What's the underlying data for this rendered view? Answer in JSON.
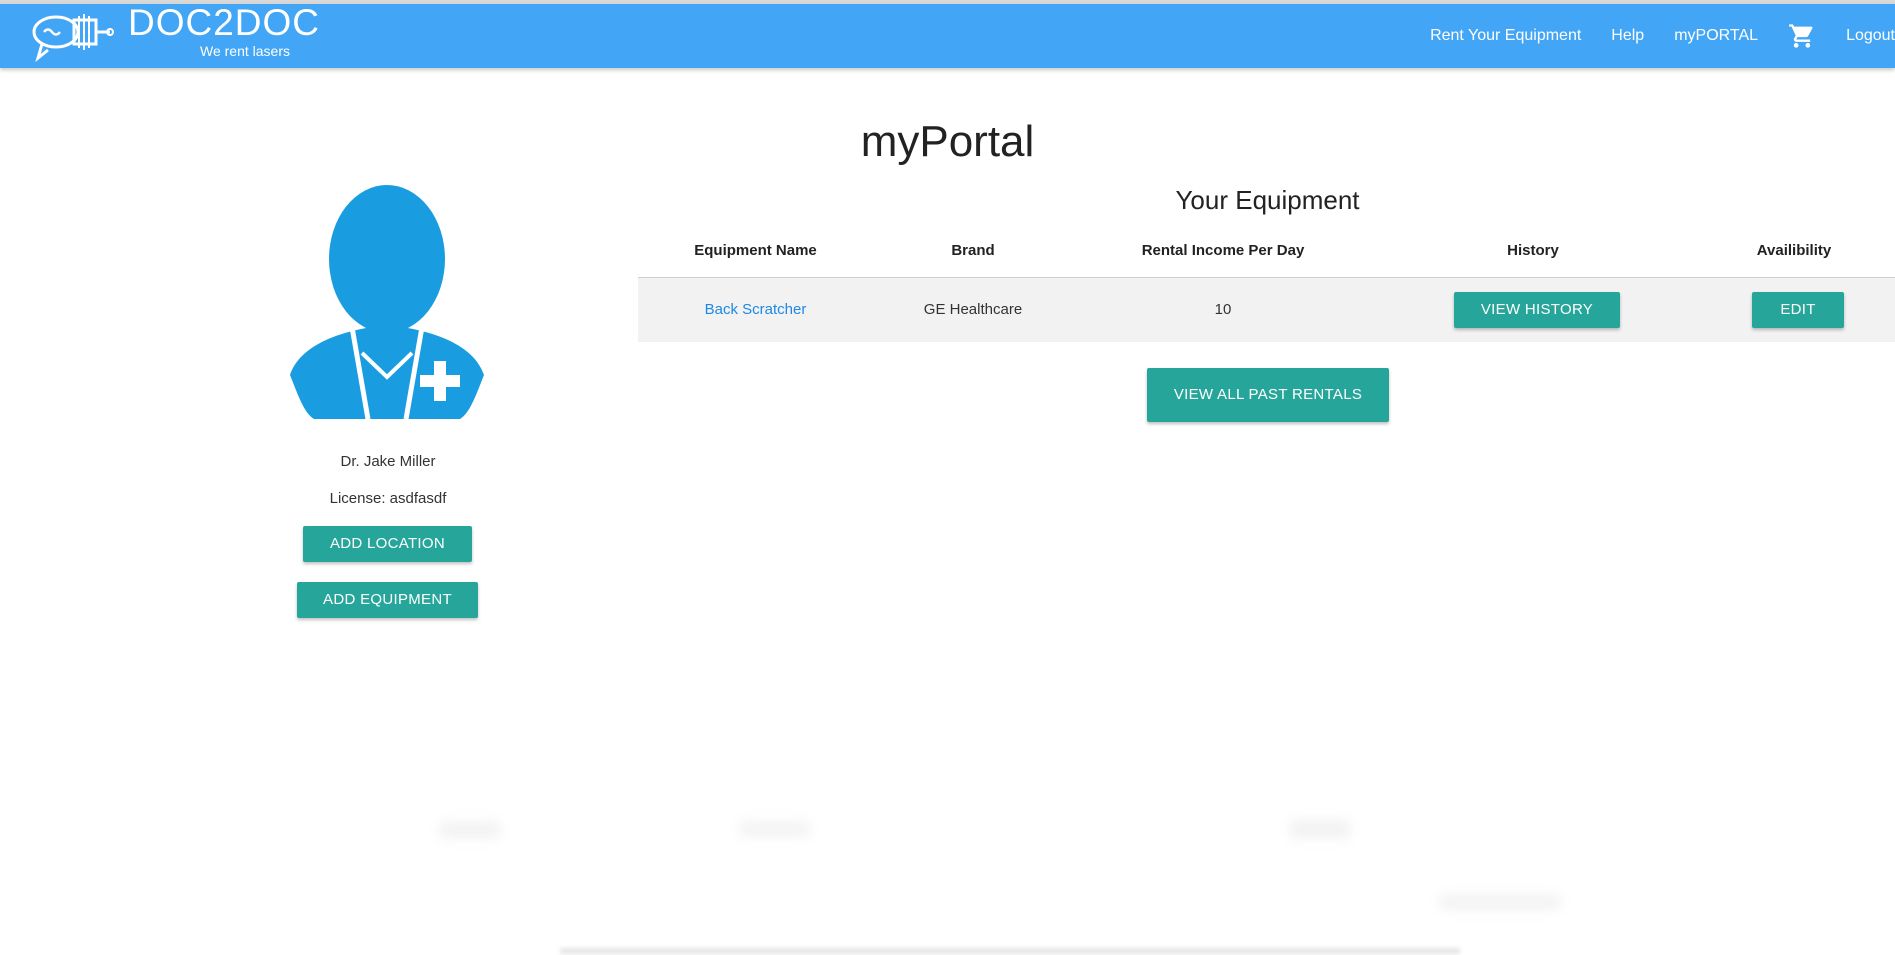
{
  "navbar": {
    "brand_name": "DOC2DOC",
    "brand_tagline": "We rent lasers",
    "links": [
      "Rent Your Equipment",
      "Help",
      "myPORTAL"
    ],
    "logout_label": "Logout",
    "cart_icon": "shopping-cart-icon",
    "background_color": "#42a5f5"
  },
  "page": {
    "title": "myPortal"
  },
  "profile": {
    "avatar_icon": "doctor-avatar-icon",
    "name": "Dr. Jake Miller",
    "license": "License: asdfasdf",
    "add_location_label": "ADD LOCATION",
    "add_equipment_label": "ADD EQUIPMENT"
  },
  "equipment": {
    "title": "Your Equipment",
    "columns": [
      "Equipment Name",
      "Brand",
      "Rental Income Per Day",
      "History",
      "Availibility"
    ],
    "rows": [
      {
        "name": "Back Scratcher",
        "brand": "GE Healthcare",
        "income": "10",
        "history_label": "VIEW HISTORY",
        "availability_label": "EDIT"
      }
    ],
    "past_rentals_label": "VIEW ALL PAST RENTALS"
  },
  "colors": {
    "accent_button": "#26a69a",
    "link": "#1e88e5",
    "avatar": "#1a9de0"
  }
}
